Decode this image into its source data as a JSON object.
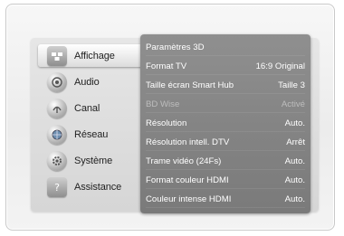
{
  "menu": {
    "items": [
      {
        "label": "Affichage",
        "icon": "display-settings-icon",
        "active": true
      },
      {
        "label": "Audio",
        "icon": "audio-speaker-icon",
        "active": false
      },
      {
        "label": "Canal",
        "icon": "antenna-channel-icon",
        "active": false
      },
      {
        "label": "Réseau",
        "icon": "network-globe-icon",
        "active": false
      },
      {
        "label": "Système",
        "icon": "gear-icon",
        "active": false
      },
      {
        "label": "Assistance",
        "icon": "help-question-icon",
        "active": false
      }
    ]
  },
  "settings": {
    "rows": [
      {
        "label": "Paramètres 3D",
        "value": "",
        "disabled": false
      },
      {
        "label": "Format TV",
        "value": "16:9 Original",
        "disabled": false
      },
      {
        "label": "Taille écran Smart Hub",
        "value": "Taille 3",
        "disabled": false
      },
      {
        "label": "BD Wise",
        "value": "Activé",
        "disabled": true
      },
      {
        "label": "Résolution",
        "value": "Auto.",
        "disabled": false
      },
      {
        "label": "Résolution intell. DTV",
        "value": "Arrêt",
        "disabled": false
      },
      {
        "label": "Trame vidéo (24Fs)",
        "value": "Auto.",
        "disabled": false
      },
      {
        "label": "Format couleur HDMI",
        "value": "Auto.",
        "disabled": false
      },
      {
        "label": "Couleur intense HDMI",
        "value": "Auto.",
        "disabled": false
      }
    ]
  },
  "colors": {
    "panel": "#858585",
    "text_light": "#ffffff",
    "text_disabled": "#bdbdbd",
    "menu_text": "#222222"
  }
}
